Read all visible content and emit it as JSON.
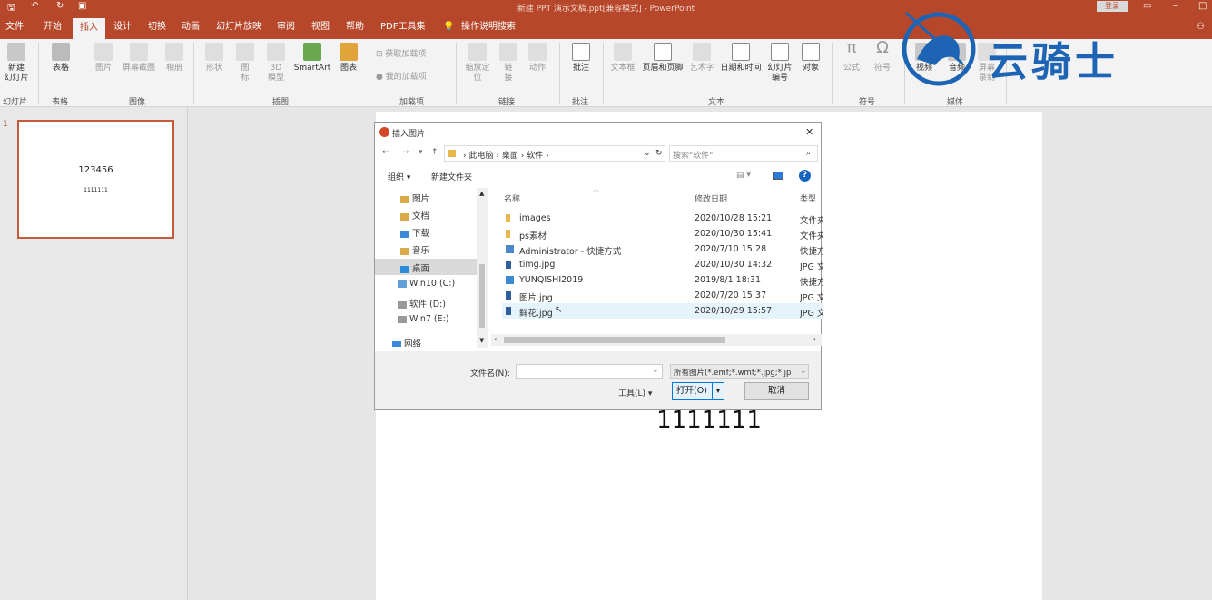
{
  "titlebar": {
    "title": "新建 PPT 演示文稿.ppt[兼容模式] - PowerPoint",
    "login": "登录"
  },
  "tabs": [
    "文件",
    "开始",
    "插入",
    "设计",
    "切换",
    "动画",
    "幻灯片放映",
    "审阅",
    "视图",
    "帮助",
    "PDF工具集",
    "操作说明搜索"
  ],
  "active_tab": "插入",
  "ribbon": {
    "new_slide": "新建\n幻灯片",
    "table": "表格",
    "picture": "图片",
    "screenshot": "屏幕截图",
    "album": "相册",
    "shapes": "形状",
    "icons": "图\n标",
    "model3d": "3D\n模型",
    "smartart": "SmartArt",
    "chart": "图表",
    "get_addins": "获取加载项",
    "my_addins": "我的加载项",
    "zoom": "缩放定\n位",
    "link": "链\n接",
    "action": "动作",
    "comment": "批注",
    "textbox": "文本框",
    "header_footer": "页眉和页脚",
    "wordart": "艺术字",
    "datetime": "日期和时间",
    "slide_number": "幻灯片\n编号",
    "object": "对象",
    "equation": "公式",
    "symbol": "符号",
    "video": "视频",
    "audio": "音频",
    "screen_record": "屏幕\n录制",
    "groups": {
      "slides": "幻灯片",
      "tables": "表格",
      "images": "图像",
      "illustrations": "插图",
      "addins": "加载项",
      "links": "链接",
      "comments": "批注",
      "text": "文本",
      "symbols": "符号",
      "media": "媒体"
    }
  },
  "thumbnail": {
    "number": "1",
    "line1": "123456",
    "line2": "1111111"
  },
  "slide": {
    "text": "1111111"
  },
  "watermark": {
    "text": "云骑士"
  },
  "dialog": {
    "title": "插入图片",
    "close": "✕",
    "breadcrumb": [
      "此电脑",
      "桌面",
      "软件"
    ],
    "search_placeholder": "搜索\"软件\"",
    "organize": "组织 ▾",
    "new_folder": "新建文件夹",
    "nav": [
      "图片",
      "文档",
      "下载",
      "音乐",
      "桌面",
      "Win10 (C:)",
      "软件 (D:)",
      "Win7 (E:)",
      "网络"
    ],
    "columns": {
      "name": "名称",
      "date": "修改日期",
      "type": "类型"
    },
    "files": [
      {
        "name": "images",
        "date": "2020/10/28 15:21",
        "type": "文件夹"
      },
      {
        "name": "ps素材",
        "date": "2020/10/30 15:41",
        "type": "文件夹"
      },
      {
        "name": "Administrator - 快捷方式",
        "date": "2020/7/10 15:28",
        "type": "快捷方式"
      },
      {
        "name": "timg.jpg",
        "date": "2020/10/30 14:32",
        "type": "JPG 文件"
      },
      {
        "name": "YUNQISHI2019",
        "date": "2019/8/1 18:31",
        "type": "快捷方式"
      },
      {
        "name": "图片.jpg",
        "date": "2020/7/20 15:37",
        "type": "JPG 文件"
      },
      {
        "name": "鲜花.jpg",
        "date": "2020/10/29 15:57",
        "type": "JPG 文件"
      }
    ],
    "filename_label": "文件名(N):",
    "filetype": "所有图片(*.emf;*.wmf;*.jpg;*.jp",
    "tools": "工具(L)",
    "open": "打开(O)",
    "cancel": "取消"
  },
  "colors": {
    "accent": "#b7472a",
    "selected_row": "#e5f3fb"
  }
}
